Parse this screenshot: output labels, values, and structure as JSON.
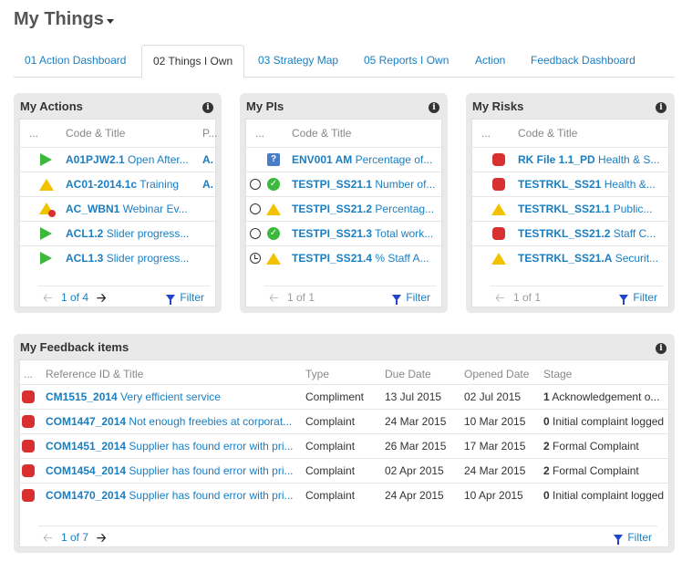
{
  "page": {
    "title": "My Things"
  },
  "tabs": [
    {
      "label": "01 Action Dashboard"
    },
    {
      "label": "02 Things I Own"
    },
    {
      "label": "03 Strategy Map"
    },
    {
      "label": "05 Reports I Own"
    },
    {
      "label": "Action"
    },
    {
      "label": "Feedback Dashboard"
    }
  ],
  "actions": {
    "title": "My Actions",
    "col_dots": "...",
    "col_code": "Code & Title",
    "col_p": "P...",
    "rows": [
      {
        "code": "A01PJW2.1",
        "title": "Open After...",
        "p": "A."
      },
      {
        "code": "AC01-2014.1c",
        "title": "Training",
        "p": "A."
      },
      {
        "code": "AC_WBN1",
        "title": "Webinar Ev...",
        "p": ""
      },
      {
        "code": "ACL1.2",
        "title": "Slider progress...",
        "p": ""
      },
      {
        "code": "ACL1.3",
        "title": "Slider progress...",
        "p": ""
      }
    ],
    "pager": "1 of 4",
    "filter": "Filter"
  },
  "pis": {
    "title": "My PIs",
    "col_dots": "...",
    "col_code": "Code & Title",
    "rows": [
      {
        "code": "ENV001 AM",
        "title": "Percentage of..."
      },
      {
        "code": "TESTPI_SS21.1",
        "title": "Number of..."
      },
      {
        "code": "TESTPI_SS21.2",
        "title": "Percentag..."
      },
      {
        "code": "TESTPI_SS21.3",
        "title": "Total work..."
      },
      {
        "code": "TESTPI_SS21.4",
        "title": "% Staff A..."
      }
    ],
    "pager": "1 of 1",
    "filter": "Filter"
  },
  "risks": {
    "title": "My Risks",
    "col_dots": "...",
    "col_code": "Code & Title",
    "rows": [
      {
        "code": "RK File 1.1_PD",
        "title": "Health & S..."
      },
      {
        "code": "TESTRKL_SS21",
        "title": "Health &..."
      },
      {
        "code": "TESTRKL_SS21.1",
        "title": "Public..."
      },
      {
        "code": "TESTRKL_SS21.2",
        "title": "Staff C..."
      },
      {
        "code": "TESTRKL_SS21.A",
        "title": "Securit..."
      }
    ],
    "pager": "1 of 1",
    "filter": "Filter"
  },
  "feedback": {
    "title": "My Feedback items",
    "col_dots": "...",
    "col_ref": "Reference ID & Title",
    "col_type": "Type",
    "col_due": "Due Date",
    "col_opened": "Opened Date",
    "col_stage": "Stage",
    "rows": [
      {
        "ref": "CM1515_2014",
        "title": "Very efficient service",
        "type": "Compliment",
        "due": "13 Jul 2015",
        "opened": "02 Jul 2015",
        "stage_num": "1",
        "stage": "Acknowledgement o..."
      },
      {
        "ref": "COM1447_2014",
        "title": "Not enough freebies at corporat...",
        "type": "Complaint",
        "due": "24 Mar 2015",
        "opened": "10 Mar 2015",
        "stage_num": "0",
        "stage": "Initial complaint logged"
      },
      {
        "ref": "COM1451_2014",
        "title": "Supplier has found error with pri...",
        "type": "Complaint",
        "due": "26 Mar 2015",
        "opened": "17 Mar 2015",
        "stage_num": "2",
        "stage": "Formal Complaint"
      },
      {
        "ref": "COM1454_2014",
        "title": "Supplier has found error with pri...",
        "type": "Complaint",
        "due": "02 Apr 2015",
        "opened": "24 Mar 2015",
        "stage_num": "2",
        "stage": "Formal Complaint"
      },
      {
        "ref": "COM1470_2014",
        "title": "Supplier has found error with pri...",
        "type": "Complaint",
        "due": "24 Apr 2015",
        "opened": "10 Apr 2015",
        "stage_num": "0",
        "stage": "Initial complaint logged"
      }
    ],
    "pager": "1 of 7",
    "filter": "Filter"
  }
}
